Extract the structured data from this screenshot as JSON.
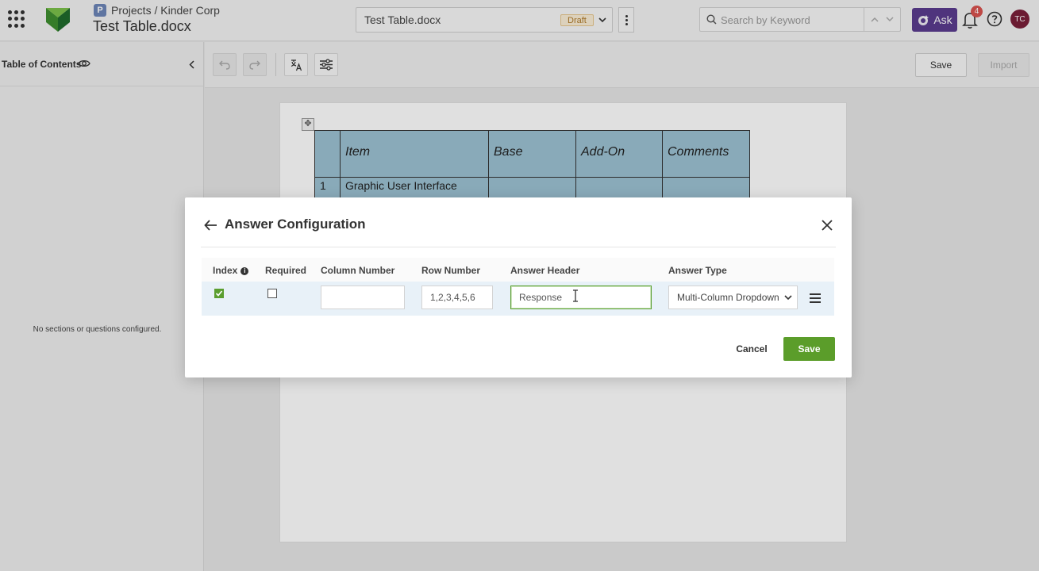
{
  "header": {
    "breadcrumb": "Projects / Kinder Corp",
    "breadcrumb_icon": "P",
    "doc_title": "Test Table.docx",
    "file_name": "Test Table.docx",
    "status_badge": "Draft",
    "search_placeholder": "Search by Keyword",
    "ask_label": "Ask",
    "notification_count": "4",
    "avatar_initials": "TC"
  },
  "sidebar": {
    "title": "Table of Contents",
    "empty_message": "No sections or questions configured."
  },
  "toolbar": {
    "save_label": "Save",
    "import_label": "Import"
  },
  "document": {
    "table_headers": [
      "",
      "Item",
      "Base",
      "Add-On",
      "Comments"
    ],
    "rows": [
      [
        "1",
        "Graphic User Interface",
        "",
        "",
        ""
      ]
    ]
  },
  "modal": {
    "title": "Answer Configuration",
    "columns": {
      "index": "Index",
      "required": "Required",
      "column_number": "Column Number",
      "row_number": "Row Number",
      "answer_header": "Answer Header",
      "answer_type": "Answer Type"
    },
    "row": {
      "index_checked": true,
      "required_checked": false,
      "column_number": "",
      "row_number": "1,2,3,4,5,6",
      "answer_header": "Response",
      "answer_type": "Multi-Column Dropdown"
    },
    "cancel_label": "Cancel",
    "save_label": "Save"
  },
  "colors": {
    "brand_green": "#5b9d2a",
    "ask_purple": "#5b3c8f",
    "table_cell_blue": "#9cc2d3",
    "draft_badge": "#fbeed6",
    "notification_red": "#d9534f"
  }
}
